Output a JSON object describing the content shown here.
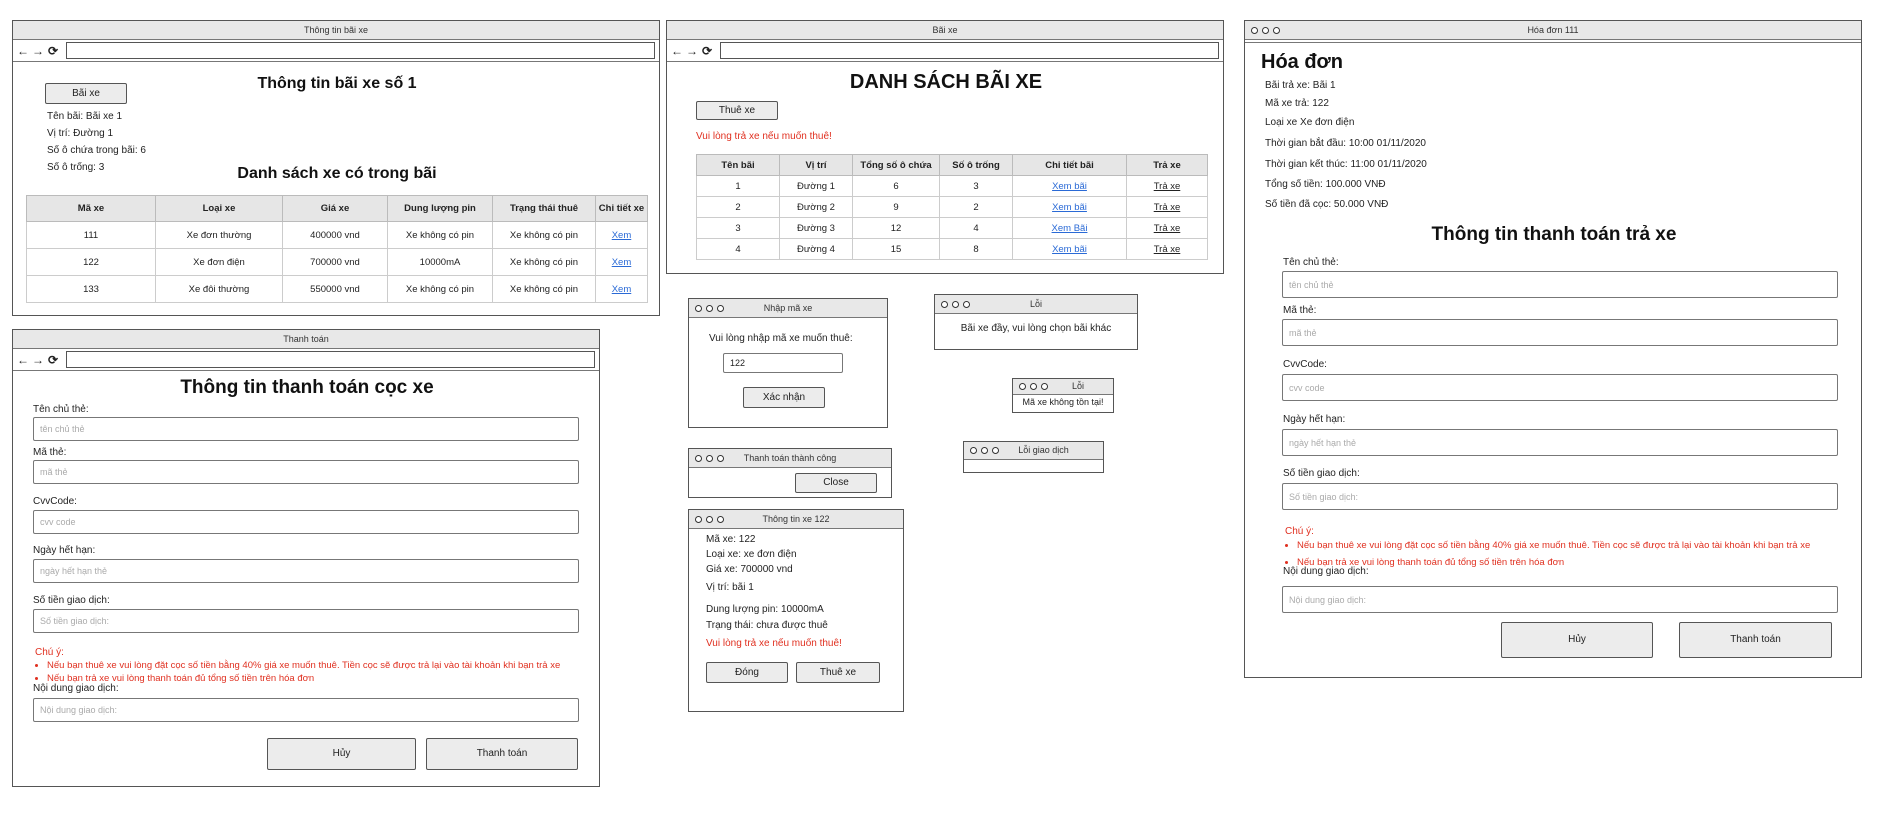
{
  "w1": {
    "window_title": "Thông tin bãi xe",
    "back_label": "Bãi xe",
    "heading": "Thông tin bãi xe số 1",
    "info": [
      "Tên bãi: Bãi xe 1",
      "Vị trí: Đường 1",
      "Số ô chứa trong bãi: 6",
      "Số ô trống: 3"
    ],
    "table_heading": "Danh sách xe có trong bãi",
    "columns": [
      "Mã xe",
      "Loại xe",
      "Giá xe",
      "Dung lượng pin",
      "Trạng thái thuê",
      "Chi tiết xe"
    ],
    "rows": [
      [
        "111",
        "Xe đơn thường",
        "400000 vnd",
        "Xe không có pin",
        "Xe không có pin",
        "Xem"
      ],
      [
        "122",
        "Xe đơn điện",
        "700000 vnd",
        "10000mA",
        "Xe không có pin",
        "Xem"
      ],
      [
        "133",
        "Xe đôi thường",
        "550000 vnd",
        "Xe không có pin",
        "Xe không có pin",
        "Xem"
      ]
    ]
  },
  "w2": {
    "window_title": "Bãi xe",
    "heading": "DANH SÁCH BÃI XE",
    "rent_label": "Thuê xe",
    "warning": "Vui lòng trả xe nếu muốn thuê!",
    "columns": [
      "Tên bãi",
      "Vị trí",
      "Tổng số ô chứa",
      "Số ô trống",
      "Chi tiết bãi",
      "Trả xe"
    ],
    "rows": [
      [
        "1",
        "Đường 1",
        "6",
        "3",
        "Xem bãi",
        "Trả xe"
      ],
      [
        "2",
        "Đường 2",
        "9",
        "2",
        "Xem bãi",
        "Trả xe"
      ],
      [
        "3",
        "Đường 3",
        "12",
        "4",
        "Xem Bãi",
        "Trả xe"
      ],
      [
        "4",
        "Đường 4",
        "15",
        "8",
        "Xem bãi",
        "Trả xe"
      ]
    ]
  },
  "w3": {
    "window_title": "Thanh toán",
    "heading": "Thông tin thanh toán cọc xe",
    "fields": [
      {
        "label": "Tên chủ thẻ:",
        "placeholder": "tên chủ thẻ"
      },
      {
        "label": "Mã thẻ:",
        "placeholder": "mã thẻ"
      },
      {
        "label": "CvvCode:",
        "placeholder": "cvv code"
      },
      {
        "label": "Ngày hết hạn:",
        "placeholder": "ngày hết hạn thẻ"
      },
      {
        "label": "Số tiền giao dịch:",
        "placeholder": "Số tiền giao dịch:"
      }
    ],
    "note_title": "Chú ý:",
    "notes": [
      "Nếu bạn thuê xe vui lòng đặt cọc số tiền bằng 40% giá xe muốn thuê. Tiền cọc sẽ được trả lại vào tài khoản khi bạn trả xe",
      "Nếu bạn trả xe vui lòng thanh toán đủ tổng số tiền trên hóa đơn"
    ],
    "content_label": "Nội dung giao dịch:",
    "content_placeholder": "Nội dung giao dịch:",
    "cancel_label": "Hủy",
    "pay_label": "Thanh toán"
  },
  "d_code": {
    "title": "Nhập mã xe",
    "prompt": "Vui lòng nhập mã xe muốn thuê:",
    "value": "122",
    "confirm_label": "Xác nhận"
  },
  "d_err1": {
    "title": "Lỗi",
    "message": "Bãi xe đầy, vui lòng chọn bãi khác"
  },
  "d_err2": {
    "title": "Lỗi",
    "message": "Mã xe không tồn tại!"
  },
  "d_err3": {
    "title": "Lỗi giao dịch"
  },
  "d_success": {
    "title": "Thanh toán thành công",
    "close_label": "Close"
  },
  "d_bike": {
    "title": "Thông tin xe 122",
    "lines": [
      "Mã xe: 122",
      "Loại xe: xe đơn điện",
      "Giá xe: 700000 vnd",
      "Vị trí: bãi 1",
      "Dung lượng pin: 10000mA",
      "Trạng thái: chưa được thuê"
    ],
    "warning": "Vui lòng trả xe nếu muốn thuê!",
    "close_label": "Đóng",
    "rent_label": "Thuê xe"
  },
  "w4": {
    "window_title": "Hóa đơn 111",
    "heading": "Hóa đơn",
    "info": [
      "Bãi trả xe: Bãi 1",
      "Mã xe trả: 122",
      "Loại xe Xe đơn điện",
      "Thời gian bắt đầu: 10:00 01/11/2020",
      "Thời gian kết thúc: 11:00 01/11/2020",
      "Tổng số tiền: 100.000 VNĐ",
      "Số tiền đã cọc: 50.000 VNĐ"
    ],
    "pay_heading": "Thông tin thanh toán trả xe",
    "fields": [
      {
        "label": "Tên chủ thẻ:",
        "placeholder": "tên chủ thẻ"
      },
      {
        "label": "Mã thẻ:",
        "placeholder": "mã thẻ"
      },
      {
        "label": "CvvCode:",
        "placeholder": "cvv code"
      },
      {
        "label": "Ngày hết hạn:",
        "placeholder": "ngày hết hạn thẻ"
      },
      {
        "label": "Số tiền giao dịch:",
        "placeholder": "Số tiền giao dịch:"
      }
    ],
    "note_title": "Chú ý:",
    "notes": [
      "Nếu bạn thuê xe vui lòng đặt cọc số tiền bằng 40% giá xe muốn thuê. Tiền cọc sẽ được trả lại vào tài khoản khi bạn trả xe",
      "Nếu bạn trả xe vui lòng thanh toán đủ tổng số tiền trên hóa đơn"
    ],
    "content_label": "Nội dung giao dịch:",
    "content_placeholder": "Nội dung giao dịch:",
    "cancel_label": "Hủy",
    "pay_label": "Thanh toán"
  },
  "icons": {
    "back": "arrow-left-icon",
    "forward": "arrow-right-icon",
    "reload": "reload-icon"
  },
  "colors": {
    "warning": "#e03020",
    "link": "#2a6ad6",
    "header_bg": "#e6e6e6"
  }
}
